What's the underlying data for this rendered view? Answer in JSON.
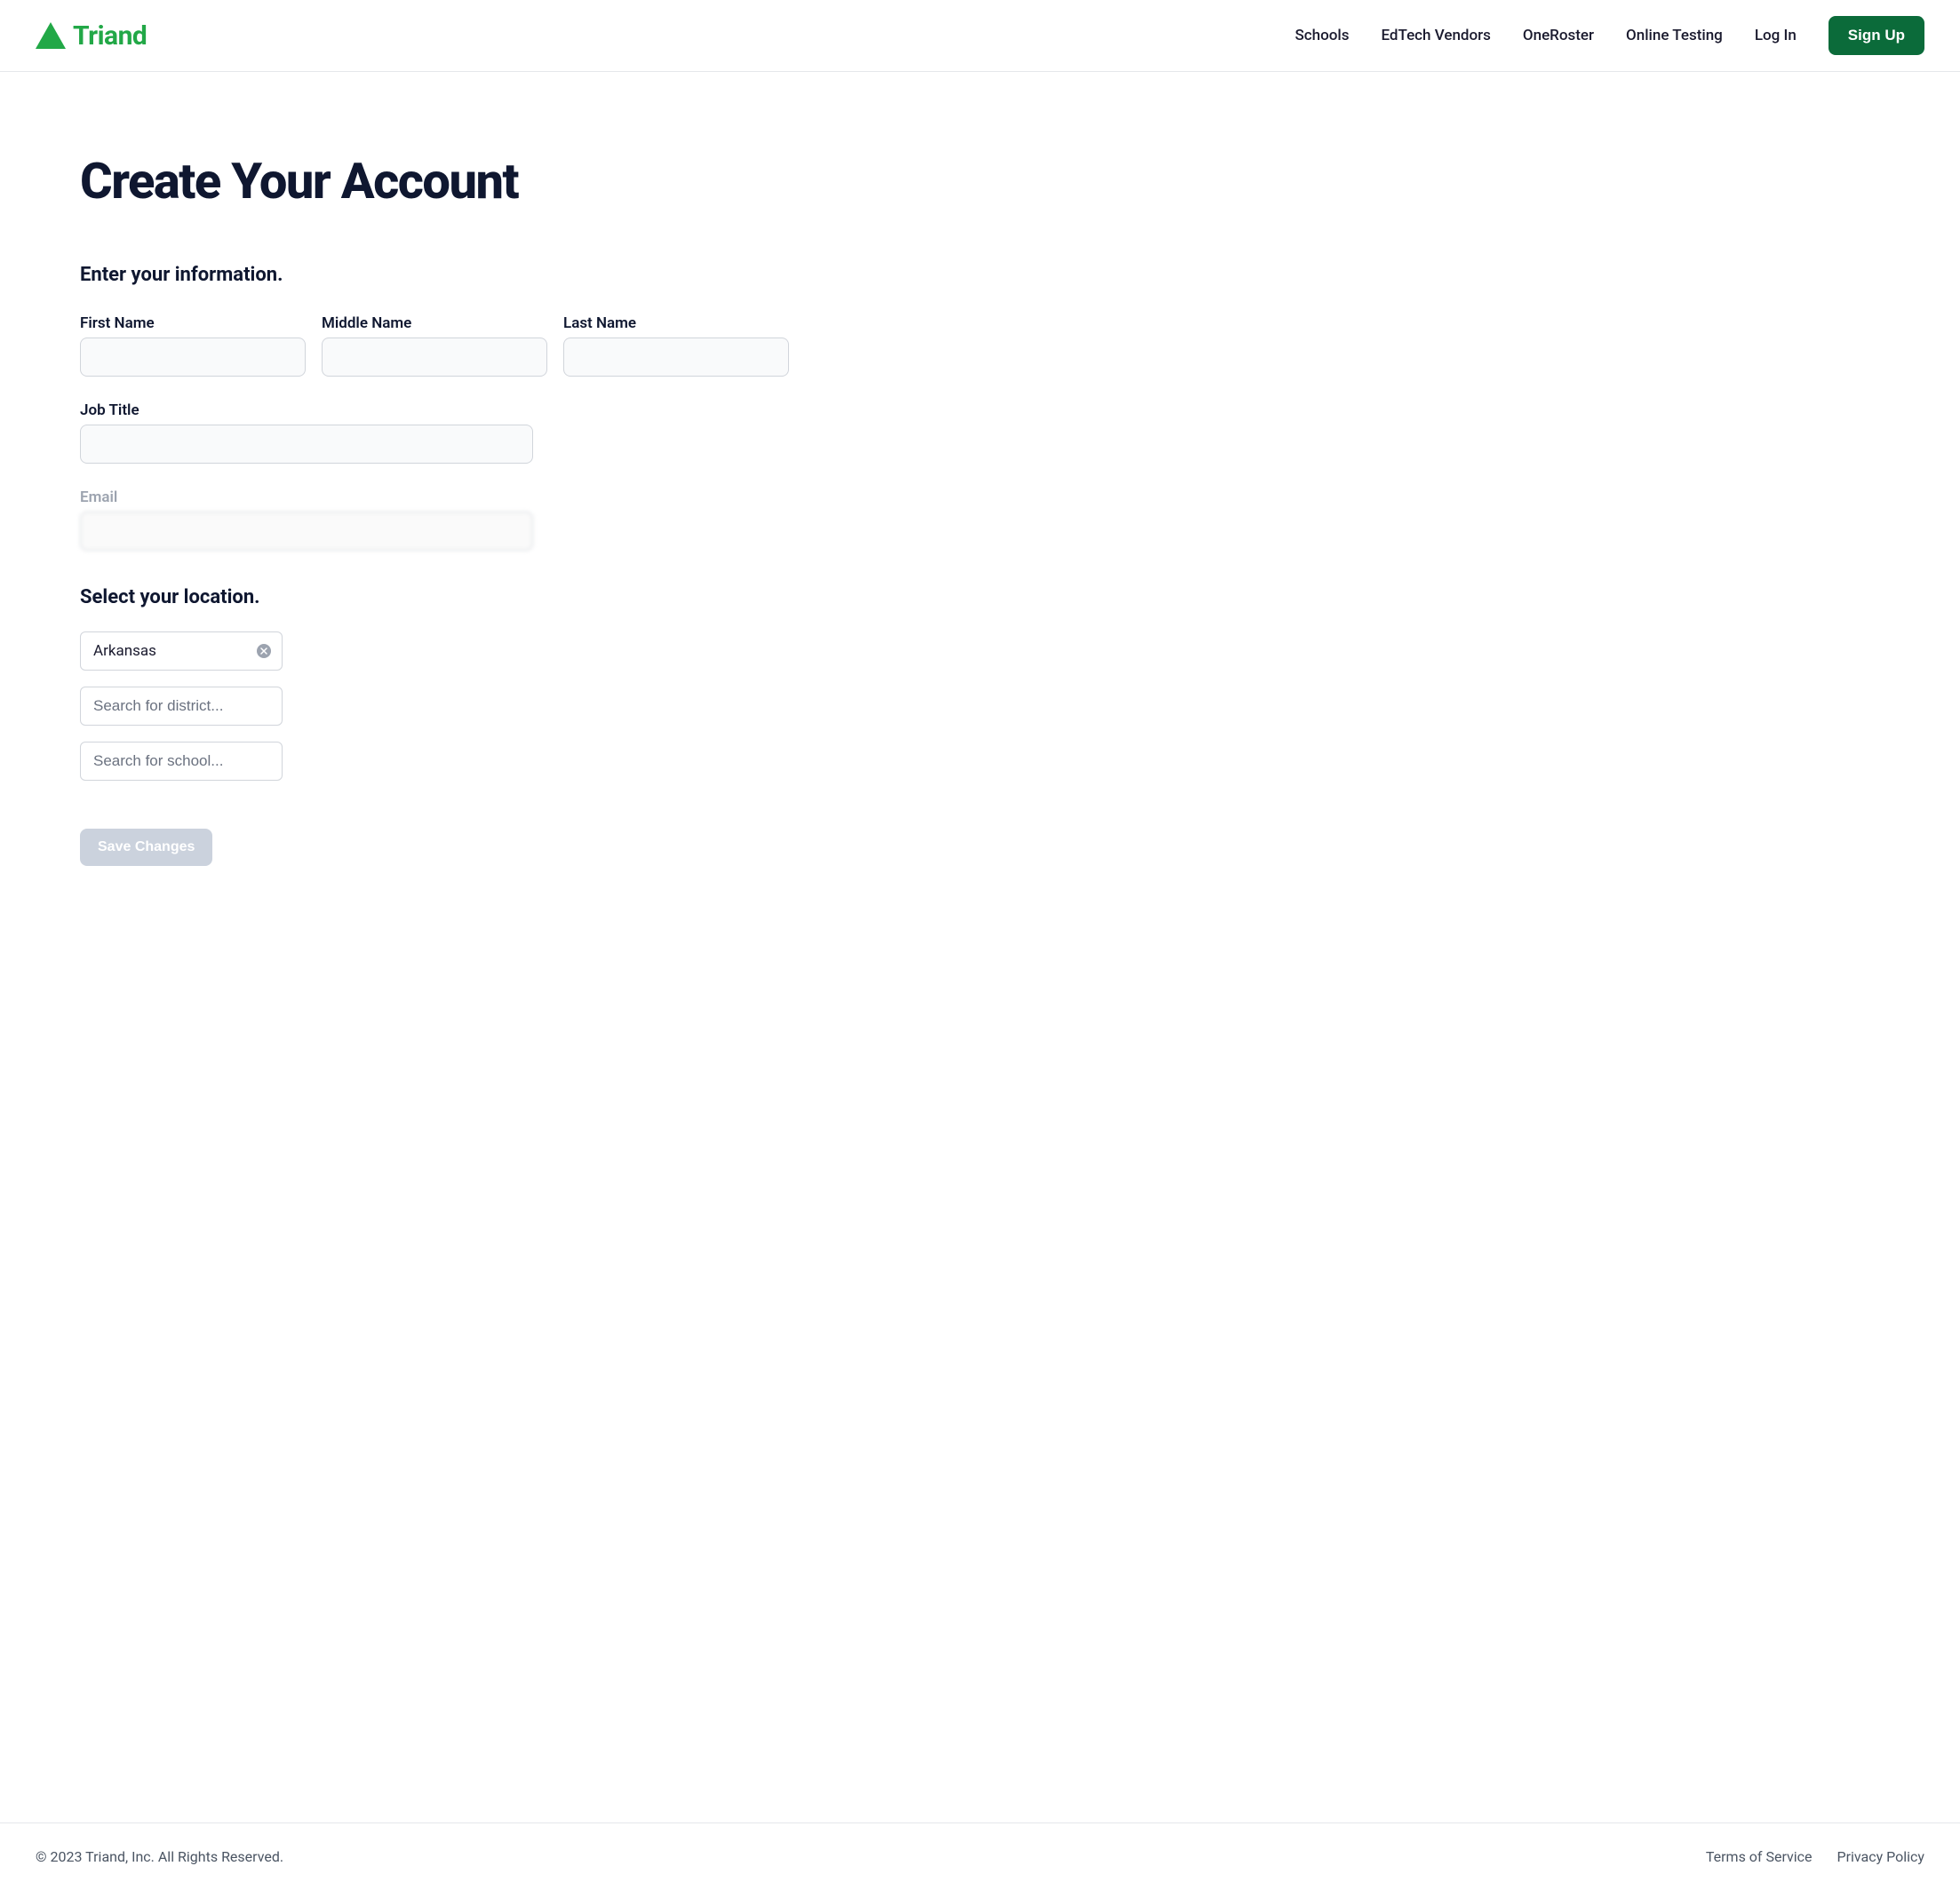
{
  "brand": {
    "name": "Triand",
    "color": "#22a847"
  },
  "nav": {
    "items": [
      {
        "label": "Schools"
      },
      {
        "label": "EdTech Vendors"
      },
      {
        "label": "OneRoster"
      },
      {
        "label": "Online Testing"
      },
      {
        "label": "Log In"
      }
    ],
    "signup_label": "Sign Up"
  },
  "page": {
    "title": "Create Your Account"
  },
  "form": {
    "info_heading": "Enter your information.",
    "first_name": {
      "label": "First Name",
      "value": ""
    },
    "middle_name": {
      "label": "Middle Name",
      "value": ""
    },
    "last_name": {
      "label": "Last Name",
      "value": ""
    },
    "job_title": {
      "label": "Job Title",
      "value": ""
    },
    "email": {
      "label": "Email",
      "value": ""
    },
    "location_heading": "Select your location.",
    "state": {
      "value": "Arkansas"
    },
    "district": {
      "placeholder": "Search for district...",
      "value": ""
    },
    "school": {
      "placeholder": "Search for school...",
      "value": ""
    },
    "save_label": "Save Changes"
  },
  "footer": {
    "copyright": "© 2023  Triand, Inc. All Rights Reserved.",
    "links": [
      {
        "label": "Terms of Service"
      },
      {
        "label": "Privacy Policy"
      }
    ]
  }
}
